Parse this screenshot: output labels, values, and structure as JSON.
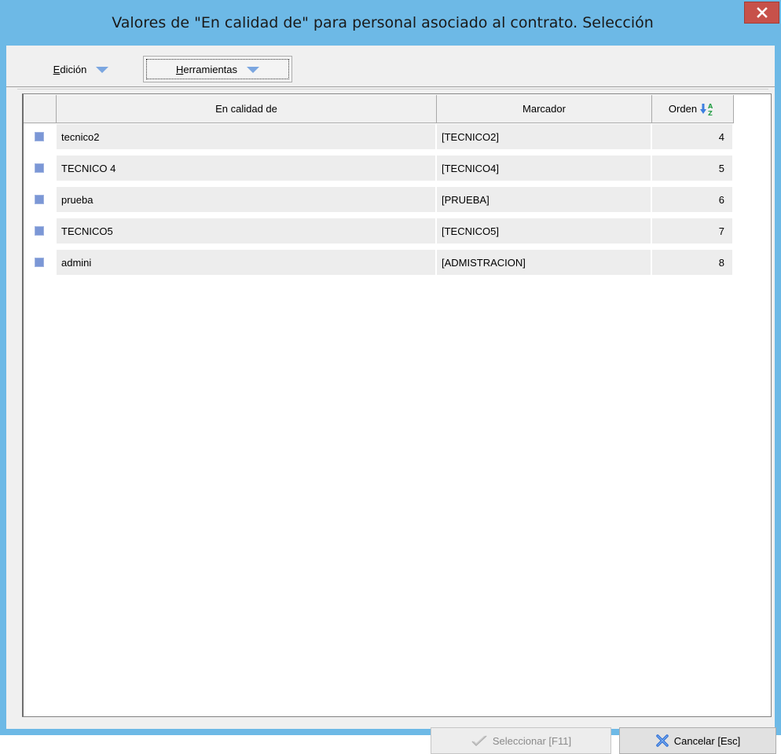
{
  "window": {
    "title": "Valores de \"En calidad de\" para personal asociado al contrato. Selección",
    "close_label": "x"
  },
  "toolbar": {
    "edicion": {
      "prefix_underlined": "E",
      "rest": "dición"
    },
    "herramientas": {
      "prefix_underlined": "H",
      "rest": "erramientas"
    }
  },
  "grid": {
    "columns": {
      "en_calidad_de": "En calidad de",
      "marcador": "Marcador",
      "orden": "Orden"
    },
    "rows": [
      {
        "en_calidad_de": "tecnico2",
        "marcador": "[TECNICO2]",
        "orden": "4"
      },
      {
        "en_calidad_de": "TECNICO 4",
        "marcador": "[TECNICO4]",
        "orden": "5"
      },
      {
        "en_calidad_de": "prueba",
        "marcador": "[PRUEBA]",
        "orden": "6"
      },
      {
        "en_calidad_de": "TECNICO5",
        "marcador": "[TECNICO5]",
        "orden": "7"
      },
      {
        "en_calidad_de": "admini",
        "marcador": "[ADMISTRACION]",
        "orden": "8"
      }
    ]
  },
  "footer": {
    "select_label": "Seleccionar [F11]",
    "cancel_label": "Cancelar [Esc]"
  },
  "icons": {
    "close": "close-icon",
    "dropdown": "chevron-down-icon",
    "sort": "sort-az-icon",
    "row_marker": "row-marker-icon",
    "select": "checkmark-icon",
    "cancel": "x-icon"
  },
  "colors": {
    "titlebar": "#6db9e6",
    "close_button": "#c7514a",
    "row_bg": "#ededed",
    "row_marker": "#7b97d6"
  }
}
